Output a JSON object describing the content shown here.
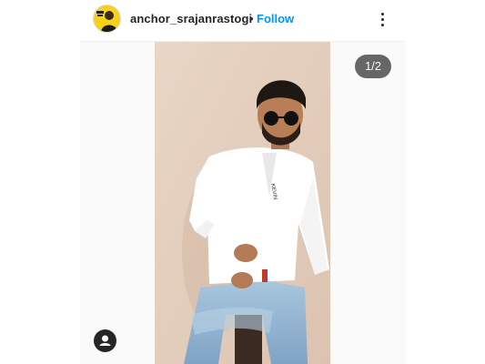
{
  "post": {
    "username": "anchor_srajanrastogi",
    "separator": "•",
    "follow_label": "Follow",
    "more_icon": "more-options-icon"
  },
  "media": {
    "counter": "1/2",
    "tag_icon": "user-tag-icon"
  },
  "colors": {
    "follow": "#0095f6",
    "text": "#262626",
    "counter_bg": "#262626"
  }
}
